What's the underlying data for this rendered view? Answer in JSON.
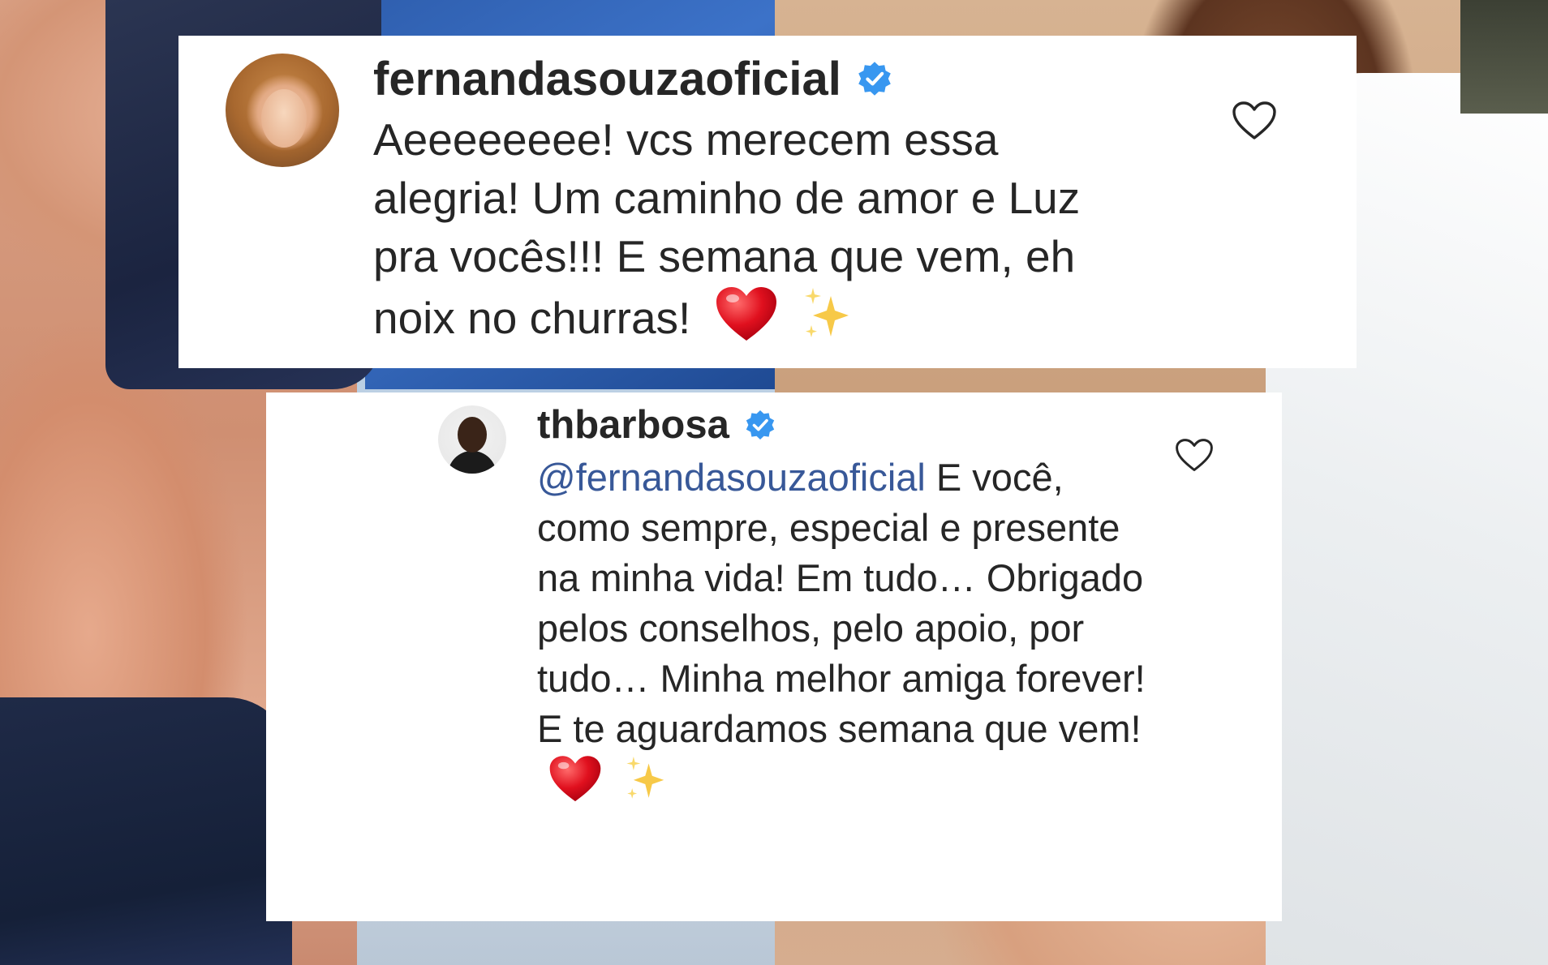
{
  "comments": [
    {
      "username": "fernandasouzaoficial",
      "verified": true,
      "text": "Aeeeeeeee! vcs merecem essa alegria! Um caminho de amor e Luz pra vocês!!! E semana que vem, eh noix no churras!",
      "emojis": [
        "red-heart",
        "sparkles"
      ]
    },
    {
      "username": "thbarbosa",
      "verified": true,
      "mention": "@fernandasouzaoficial",
      "text": " E você, como sempre, especial e presente na minha vida! Em tudo… Obrigado pelos conselhos, pelo apoio, por tudo… Minha melhor amiga forever! E te aguardamos semana que vem!",
      "emojis": [
        "red-heart",
        "sparkles"
      ]
    }
  ],
  "icons": {
    "verified_color": "#3897f0",
    "heart_outline_color": "#262626",
    "emoji_heart_color": "#e0101e",
    "emoji_sparkle_color": "#f7c948"
  }
}
